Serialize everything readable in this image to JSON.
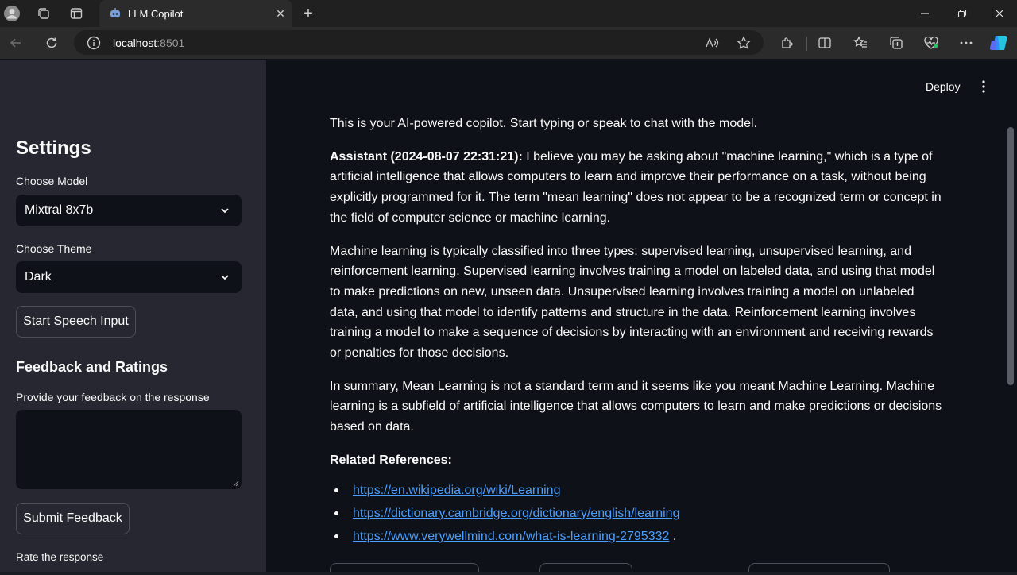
{
  "browser": {
    "tab_title": "LLM Copilot",
    "url_host": "localhost",
    "url_port": ":8501"
  },
  "sidebar": {
    "title": "Settings",
    "model_label": "Choose Model",
    "model_value": "Mixtral 8x7b",
    "theme_label": "Choose Theme",
    "theme_value": "Dark",
    "speech_button": "Start Speech Input",
    "feedback_heading": "Feedback and Ratings",
    "feedback_label": "Provide your feedback on the response",
    "feedback_value": "",
    "submit_button": "Submit Feedback",
    "rate_label": "Rate the response"
  },
  "main": {
    "deploy_label": "Deploy",
    "intro": "This is your AI-powered copilot. Start typing or speak to chat with the model.",
    "assistant_prefix": "Assistant (2024-08-07 22:31:21):",
    "paragraph1": " I believe you may be asking about \"machine learning,\" which is a type of artificial intelligence that allows computers to learn and improve their performance on a task, without being explicitly programmed for it. The term \"mean learning\" does not appear to be a recognized term or concept in the field of computer science or machine learning.",
    "paragraph2": "Machine learning is typically classified into three types: supervised learning, unsupervised learning, and reinforcement learning. Supervised learning involves training a model on labeled data, and using that model to make predictions on new, unseen data. Unsupervised learning involves training a model on unlabeled data, and using that model to identify patterns and structure in the data. Reinforcement learning involves training a model to make a sequence of decisions by interacting with an environment and receiving rewards or penalties for those decisions.",
    "paragraph3": "In summary, Mean Learning is not a standard term and it seems like you meant Machine Learning. Machine learning is a subfield of artificial intelligence that allows computers to learn and make predictions or decisions based on data.",
    "references_heading": "Related References:",
    "references": [
      "https://en.wikipedia.org/wiki/Learning",
      "https://dictionary.cambridge.org/dictionary/english/learning",
      "https://www.verywellmind.com/what-is-learning-2795332"
    ],
    "reference_3_suffix": " ."
  },
  "colors": {
    "accent": "#ff4b4b",
    "link": "#4a9eff",
    "sidebar_bg": "#262730",
    "main_bg": "#0e1117"
  }
}
